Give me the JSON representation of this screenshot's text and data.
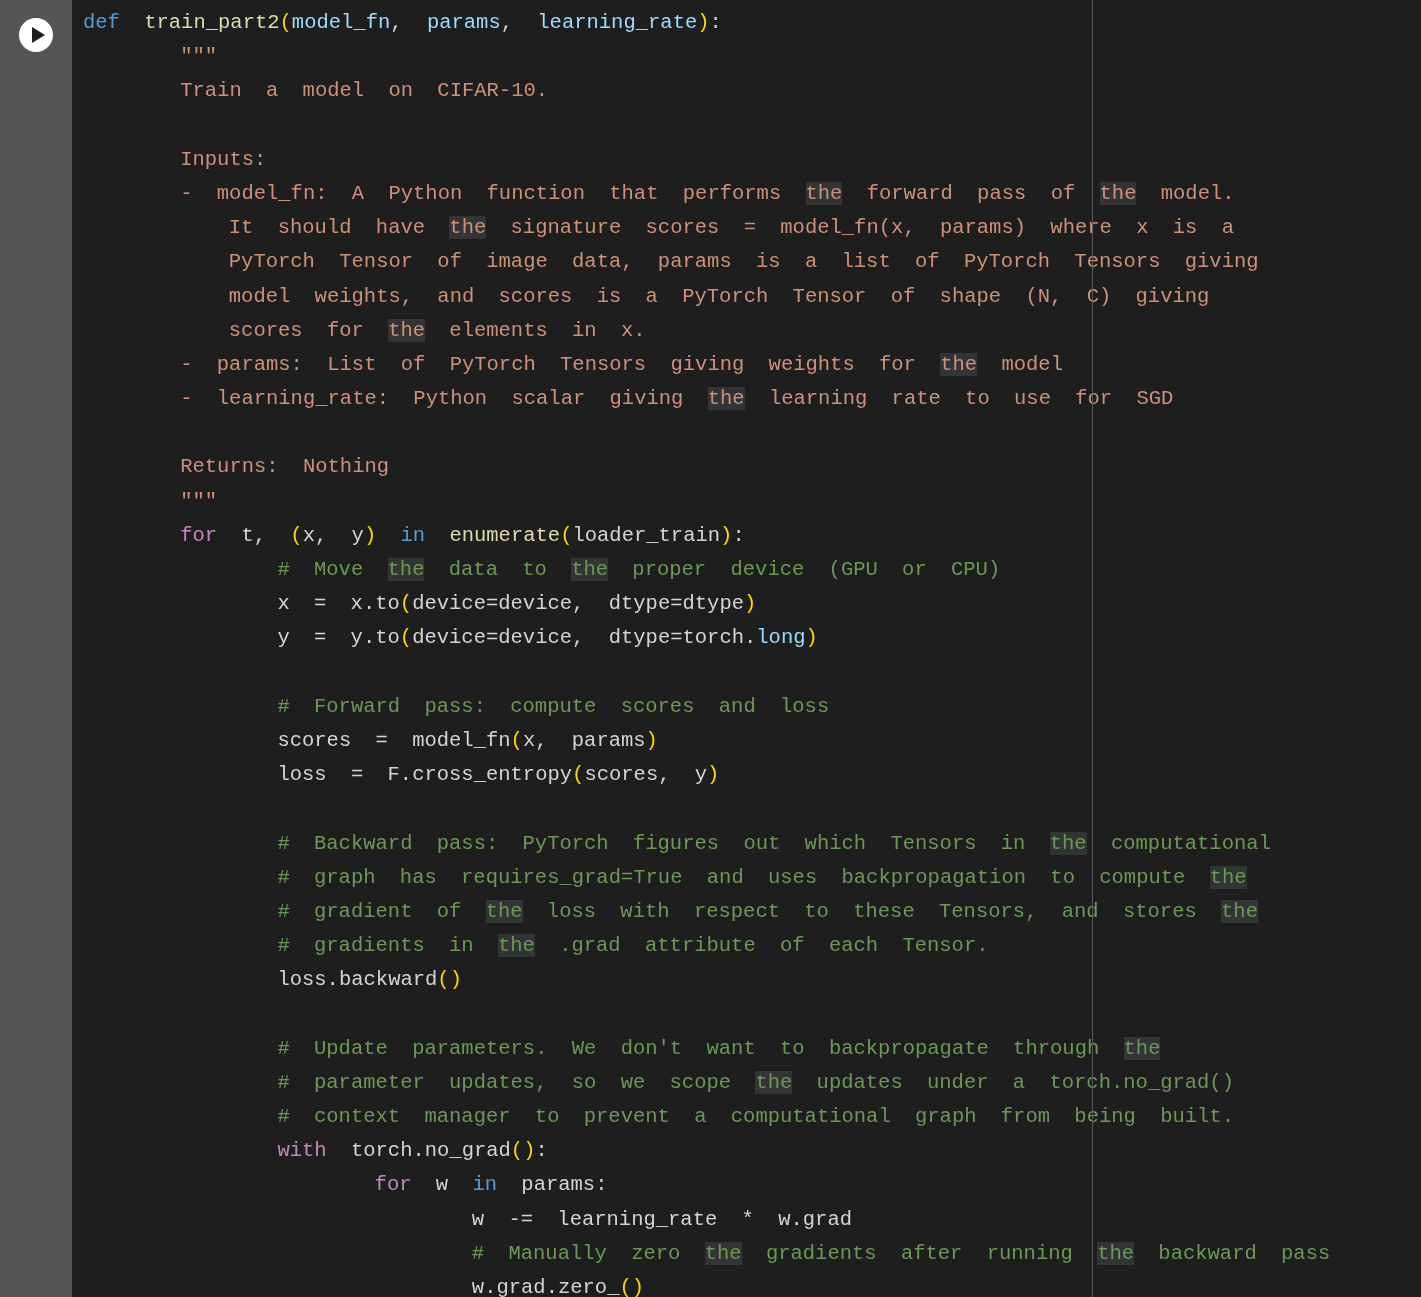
{
  "cell": {
    "lines": [
      {
        "kind": "code",
        "tokens": [
          {
            "text": "def ",
            "kind": "keyword"
          },
          {
            "text": "train_part2",
            "kind": "function"
          },
          {
            "text": "(",
            "kind": "paren"
          },
          {
            "text": "model_fn",
            "kind": "param"
          },
          {
            "text": ", ",
            "kind": "plain"
          },
          {
            "text": "params",
            "kind": "param"
          },
          {
            "text": ", ",
            "kind": "plain"
          },
          {
            "text": "learning_rate",
            "kind": "param"
          },
          {
            "text": ")",
            "kind": "paren"
          },
          {
            "text": ":",
            "kind": "plain"
          }
        ]
      },
      {
        "kind": "code",
        "tokens": [
          {
            "text": "    \"\"\"",
            "kind": "doc"
          }
        ]
      },
      {
        "kind": "code",
        "tokens": [
          {
            "text": "    Train a model on CIFAR-10.",
            "kind": "doc"
          }
        ]
      },
      {
        "kind": "blank"
      },
      {
        "kind": "code",
        "tokens": [
          {
            "text": "    Inputs:",
            "kind": "doc"
          }
        ]
      },
      {
        "kind": "code",
        "tokens": [
          {
            "text": "    - model_fn: A Python function that performs ",
            "kind": "doc"
          },
          {
            "text": "the",
            "kind": "doc-match"
          },
          {
            "text": " forward pass of ",
            "kind": "doc"
          },
          {
            "text": "the",
            "kind": "doc-match"
          },
          {
            "text": " model.",
            "kind": "doc"
          }
        ]
      },
      {
        "kind": "code",
        "tokens": [
          {
            "text": "      It should have ",
            "kind": "doc"
          },
          {
            "text": "the",
            "kind": "doc-match"
          },
          {
            "text": " signature scores = model_fn(x, params) where x is a",
            "kind": "doc"
          }
        ]
      },
      {
        "kind": "code",
        "tokens": [
          {
            "text": "      PyTorch Tensor of image data, params is a list of PyTorch Tensors giving",
            "kind": "doc"
          }
        ]
      },
      {
        "kind": "code",
        "tokens": [
          {
            "text": "      model weights, and scores is a PyTorch Tensor of shape (N, C) giving",
            "kind": "doc"
          }
        ]
      },
      {
        "kind": "code",
        "tokens": [
          {
            "text": "      scores for ",
            "kind": "doc"
          },
          {
            "text": "the",
            "kind": "doc-match"
          },
          {
            "text": " elements in x.",
            "kind": "doc"
          }
        ]
      },
      {
        "kind": "code",
        "tokens": [
          {
            "text": "    - params: List of PyTorch Tensors giving weights for ",
            "kind": "doc"
          },
          {
            "text": "the",
            "kind": "doc-match"
          },
          {
            "text": " model",
            "kind": "doc"
          }
        ]
      },
      {
        "kind": "code",
        "tokens": [
          {
            "text": "    - learning_rate: Python scalar giving ",
            "kind": "doc"
          },
          {
            "text": "the",
            "kind": "doc-match"
          },
          {
            "text": " learning rate to use for SGD",
            "kind": "doc"
          }
        ]
      },
      {
        "kind": "blank"
      },
      {
        "kind": "code",
        "tokens": [
          {
            "text": "    Returns: Nothing",
            "kind": "doc"
          }
        ]
      },
      {
        "kind": "code",
        "tokens": [
          {
            "text": "    \"\"\"",
            "kind": "doc"
          }
        ]
      },
      {
        "kind": "code",
        "tokens": [
          {
            "text": "    for",
            "kind": "control"
          },
          {
            "text": " t, ",
            "kind": "plain"
          },
          {
            "text": "(",
            "kind": "paren"
          },
          {
            "text": "x, y",
            "kind": "plain"
          },
          {
            "text": ")",
            "kind": "paren"
          },
          {
            "text": " in",
            "kind": "keyword"
          },
          {
            "text": " enumerate",
            "kind": "function"
          },
          {
            "text": "(",
            "kind": "paren"
          },
          {
            "text": "loader_train",
            "kind": "plain"
          },
          {
            "text": ")",
            "kind": "paren"
          },
          {
            "text": ":",
            "kind": "plain"
          }
        ]
      },
      {
        "kind": "code",
        "tokens": [
          {
            "text": "        # Move ",
            "kind": "comment"
          },
          {
            "text": "the",
            "kind": "comment-match"
          },
          {
            "text": " data to ",
            "kind": "comment"
          },
          {
            "text": "the",
            "kind": "comment-match"
          },
          {
            "text": " proper device (GPU or CPU)",
            "kind": "comment"
          }
        ]
      },
      {
        "kind": "code",
        "tokens": [
          {
            "text": "        x = x.to",
            "kind": "plain"
          },
          {
            "text": "(",
            "kind": "paren"
          },
          {
            "text": "device=device, dtype=dtype",
            "kind": "plain"
          },
          {
            "text": ")",
            "kind": "paren"
          }
        ]
      },
      {
        "kind": "code",
        "tokens": [
          {
            "text": "        y = y.to",
            "kind": "plain"
          },
          {
            "text": "(",
            "kind": "paren"
          },
          {
            "text": "device=device, dtype=torch.",
            "kind": "plain"
          },
          {
            "text": "long",
            "kind": "property"
          },
          {
            "text": ")",
            "kind": "paren"
          }
        ]
      },
      {
        "kind": "blank"
      },
      {
        "kind": "code",
        "tokens": [
          {
            "text": "        # Forward pass: compute scores and loss",
            "kind": "comment"
          }
        ]
      },
      {
        "kind": "code",
        "tokens": [
          {
            "text": "        scores = model_fn",
            "kind": "plain"
          },
          {
            "text": "(",
            "kind": "paren"
          },
          {
            "text": "x, params",
            "kind": "plain"
          },
          {
            "text": ")",
            "kind": "paren"
          }
        ]
      },
      {
        "kind": "code",
        "tokens": [
          {
            "text": "        loss = F.cross_entropy",
            "kind": "plain"
          },
          {
            "text": "(",
            "kind": "paren"
          },
          {
            "text": "scores, y",
            "kind": "plain"
          },
          {
            "text": ")",
            "kind": "paren"
          }
        ]
      },
      {
        "kind": "blank"
      },
      {
        "kind": "code",
        "tokens": [
          {
            "text": "        # Backward pass: PyTorch figures out which Tensors in ",
            "kind": "comment"
          },
          {
            "text": "the",
            "kind": "comment-match"
          },
          {
            "text": " computational",
            "kind": "comment"
          }
        ]
      },
      {
        "kind": "code",
        "tokens": [
          {
            "text": "        # graph has requires_grad=True and uses backpropagation to compute ",
            "kind": "comment"
          },
          {
            "text": "the",
            "kind": "comment-match"
          }
        ]
      },
      {
        "kind": "code",
        "tokens": [
          {
            "text": "        # gradient of ",
            "kind": "comment"
          },
          {
            "text": "the",
            "kind": "comment-match"
          },
          {
            "text": " loss with respect to these Tensors, and stores ",
            "kind": "comment"
          },
          {
            "text": "the",
            "kind": "comment-match"
          }
        ]
      },
      {
        "kind": "code",
        "tokens": [
          {
            "text": "        # gradients in ",
            "kind": "comment"
          },
          {
            "text": "the",
            "kind": "comment-match"
          },
          {
            "text": " .grad attribute of each Tensor.",
            "kind": "comment"
          }
        ]
      },
      {
        "kind": "code",
        "tokens": [
          {
            "text": "        loss.backward",
            "kind": "plain"
          },
          {
            "text": "()",
            "kind": "paren"
          }
        ]
      },
      {
        "kind": "blank"
      },
      {
        "kind": "code",
        "tokens": [
          {
            "text": "        # Update parameters. We don't want to backpropagate through ",
            "kind": "comment"
          },
          {
            "text": "the",
            "kind": "comment-match"
          }
        ]
      },
      {
        "kind": "code",
        "tokens": [
          {
            "text": "        # parameter updates, so we scope ",
            "kind": "comment"
          },
          {
            "text": "the",
            "kind": "comment-match"
          },
          {
            "text": " updates under a torch.no_grad()",
            "kind": "comment"
          }
        ]
      },
      {
        "kind": "code",
        "tokens": [
          {
            "text": "        # context manager to prevent a computational graph from being built.",
            "kind": "comment"
          }
        ]
      },
      {
        "kind": "code",
        "tokens": [
          {
            "text": "        with",
            "kind": "control"
          },
          {
            "text": " torch.no_grad",
            "kind": "plain"
          },
          {
            "text": "()",
            "kind": "paren"
          },
          {
            "text": ":",
            "kind": "plain"
          }
        ]
      },
      {
        "kind": "code",
        "tokens": [
          {
            "text": "            for",
            "kind": "control"
          },
          {
            "text": " w ",
            "kind": "plain"
          },
          {
            "text": "in",
            "kind": "keyword"
          },
          {
            "text": " params:",
            "kind": "plain"
          }
        ]
      },
      {
        "kind": "code",
        "tokens": [
          {
            "text": "                w -= learning_rate * w.grad",
            "kind": "plain"
          }
        ]
      },
      {
        "kind": "code",
        "tokens": [
          {
            "text": "                # Manually zero ",
            "kind": "comment"
          },
          {
            "text": "the",
            "kind": "comment-match"
          },
          {
            "text": " gradients after running ",
            "kind": "comment"
          },
          {
            "text": "the",
            "kind": "comment-match"
          },
          {
            "text": " backward pass",
            "kind": "comment"
          }
        ]
      },
      {
        "kind": "code",
        "tokens": [
          {
            "text": "                w.grad.zero_",
            "kind": "plain"
          },
          {
            "text": "()",
            "kind": "paren"
          }
        ]
      }
    ]
  }
}
